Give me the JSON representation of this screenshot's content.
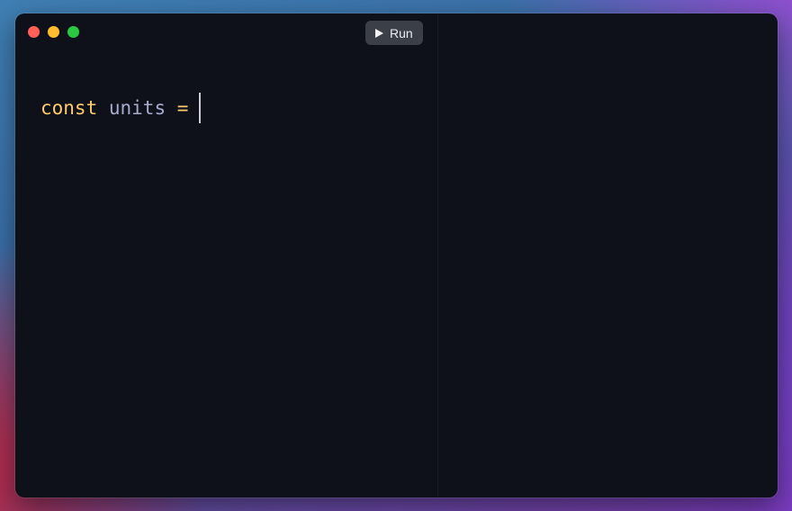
{
  "toolbar": {
    "run_label": "Run"
  },
  "editor": {
    "tokens": {
      "keyword": "const",
      "identifier": "units",
      "operator": "="
    }
  },
  "icons": {
    "run": "play-icon",
    "window_controls": [
      "close-icon",
      "minimize-icon",
      "maximize-icon"
    ]
  },
  "colors": {
    "background": "#0f111a",
    "keyword": "#ffcb6b",
    "identifier": "#a6accd",
    "run_button": "#3b3f48",
    "close": "#fe5f57",
    "minimize": "#febc2e",
    "maximize": "#28c840"
  }
}
